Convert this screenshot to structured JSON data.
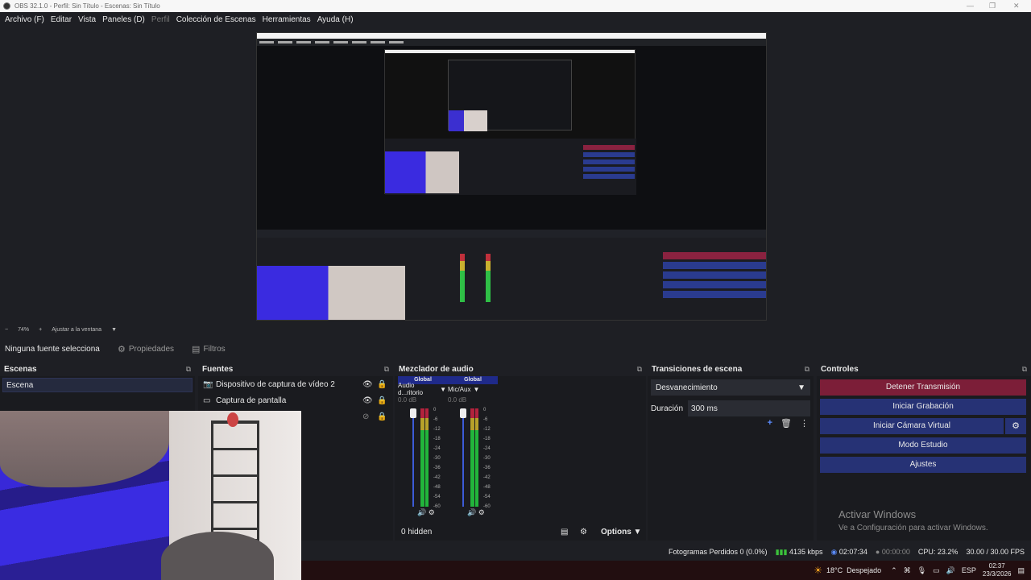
{
  "window": {
    "title": "OBS 32.1.0 - Perfil: Sin Título - Escenas: Sin Título"
  },
  "menu": {
    "items": [
      {
        "label": "Archivo (F)",
        "enabled": true
      },
      {
        "label": "Editar",
        "enabled": true
      },
      {
        "label": "Vista",
        "enabled": true
      },
      {
        "label": "Paneles (D)",
        "enabled": true
      },
      {
        "label": "Perfil",
        "enabled": false
      },
      {
        "label": "Colección de Escenas",
        "enabled": true
      },
      {
        "label": "Herramientas",
        "enabled": true
      },
      {
        "label": "Ayuda (H)",
        "enabled": true
      }
    ]
  },
  "zoom": {
    "minus": "−",
    "value": "74%",
    "plus": "+",
    "fit": "Ajustar a la ventana"
  },
  "source_toolbar": {
    "no_source": "Ninguna fuente seleccionada",
    "properties": "Propiedades",
    "filters": "Filtros"
  },
  "scenes": {
    "title": "Escenas",
    "items": [
      "Escena"
    ]
  },
  "sources": {
    "title": "Fuentes",
    "items": [
      {
        "name": "Dispositivo de captura de vídeo 2",
        "icon": "camera-icon",
        "visible": true
      },
      {
        "name": "Captura de pantalla",
        "icon": "monitor-icon",
        "visible": true
      },
      {
        "name": "",
        "icon": "",
        "visible": false
      }
    ]
  },
  "mixer": {
    "title": "Mezclador de audio",
    "channels": [
      {
        "global": "Global",
        "name": "Audio d...ritorio",
        "db": "0.0 dB"
      },
      {
        "global": "Global",
        "name": "Mic/Aux",
        "db": "0.0 dB"
      }
    ],
    "scale": [
      "0",
      "-6",
      "-12",
      "-18",
      "-24",
      "-30",
      "-36",
      "-42",
      "-48",
      "-54",
      "-60"
    ],
    "hidden": "0 hidden",
    "options": "Options"
  },
  "transitions": {
    "title": "Transiciones de escena",
    "selected": "Desvanecimiento",
    "duration_label": "Duración",
    "duration_value": "300 ms"
  },
  "controls": {
    "title": "Controles",
    "stop_stream": "Detener Transmisión",
    "start_recording": "Iniciar Grabación",
    "start_virtual_cam": "Iniciar Cámara Virtual",
    "studio_mode": "Modo Estudio",
    "settings": "Ajustes"
  },
  "activation": {
    "line1": "Activar Windows",
    "line2": "Ve a Configuración para activar Windows."
  },
  "status": {
    "dropped": "Fotogramas Perdidos 0 (0.0%)",
    "bitrate": "4135 kbps",
    "stream_time": "02:07:34",
    "rec_time": "00:00:00",
    "cpu": "CPU: 23.2%",
    "fps": "30.00 / 30.00 FPS"
  },
  "taskbar": {
    "temp": "18°C",
    "weather": "Despejado",
    "lang": "ESP",
    "time": "02:37",
    "date": "23/3/2026"
  },
  "colors": {
    "accent": "#263275",
    "stop": "#7c1e38",
    "global_header": "#1f2a8a"
  }
}
